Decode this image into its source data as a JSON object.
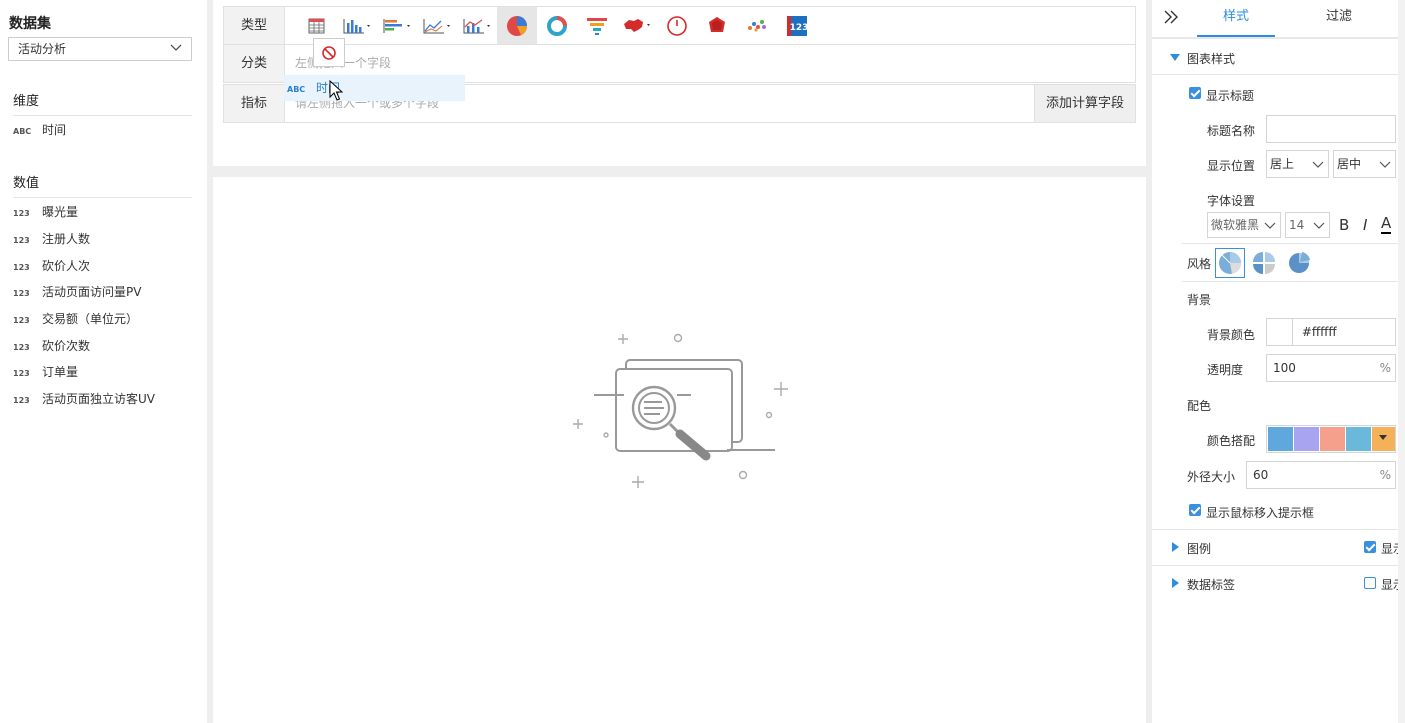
{
  "dataset": {
    "title": "数据集",
    "selected": "活动分析",
    "dimensions_title": "维度",
    "dimensions": [
      {
        "type": "ABC",
        "name": "时间"
      }
    ],
    "measures_title": "数值",
    "measures": [
      {
        "type": "123",
        "name": "曝光量"
      },
      {
        "type": "123",
        "name": "注册人数"
      },
      {
        "type": "123",
        "name": "砍价人次"
      },
      {
        "type": "123",
        "name": "活动页面访问量PV"
      },
      {
        "type": "123",
        "name": "交易额（单位元）"
      },
      {
        "type": "123",
        "name": "砍价次数"
      },
      {
        "type": "123",
        "name": "订单量"
      },
      {
        "type": "123",
        "name": "活动页面独立访客UV"
      }
    ]
  },
  "config": {
    "type_label": "类型",
    "category_label": "分类",
    "category_placeholder": "左侧拖入一个字段",
    "metric_label": "指标",
    "metric_placeholder": "请左侧拖入一个或多个字段",
    "add_calc_button": "添加计算字段",
    "chart_types": [
      "table-icon",
      "bar-chart-icon",
      "horizontal-bar-icon",
      "line-chart-icon",
      "combo-chart-icon",
      "pie-chart-icon",
      "ring-chart-icon",
      "funnel-chart-icon",
      "map-icon",
      "gauge-icon",
      "radar-icon",
      "scatter-icon",
      "number-card-icon"
    ],
    "active_type": "pie-chart-icon"
  },
  "drag": {
    "type": "ABC",
    "name": "时间"
  },
  "panel": {
    "tab_style": "样式",
    "tab_filter": "过滤",
    "chart_style": "图表样式",
    "show_title": "显示标题",
    "title_name_label": "标题名称",
    "title_name_value": "",
    "position_label": "显示位置",
    "position_v": "居上",
    "position_h": "居中",
    "font_label": "字体设置",
    "font_family": "微软雅黑",
    "font_size": "14",
    "bold": "B",
    "italic": "I",
    "underline_color": "A",
    "style_label": "风格",
    "bg_label": "背景",
    "bg_color_label": "背景颜色",
    "bg_color_value": "#ffffff",
    "opacity_label": "透明度",
    "opacity_value": "100",
    "percent": "%",
    "palette_label": "配色",
    "palette_sub_label": "颜色搭配",
    "palette": [
      "#5fa8dd",
      "#a8a4ef",
      "#f4a08c",
      "#6ab9db",
      "#f5b15a"
    ],
    "radius_label": "外径大小",
    "radius_value": "60",
    "show_tooltip": "显示鼠标移入提示框",
    "legend": "图例",
    "legend_show": "显示",
    "data_label": "数据标签",
    "data_label_show": "显示"
  },
  "colors": {
    "accent": "#2d8ee0"
  }
}
